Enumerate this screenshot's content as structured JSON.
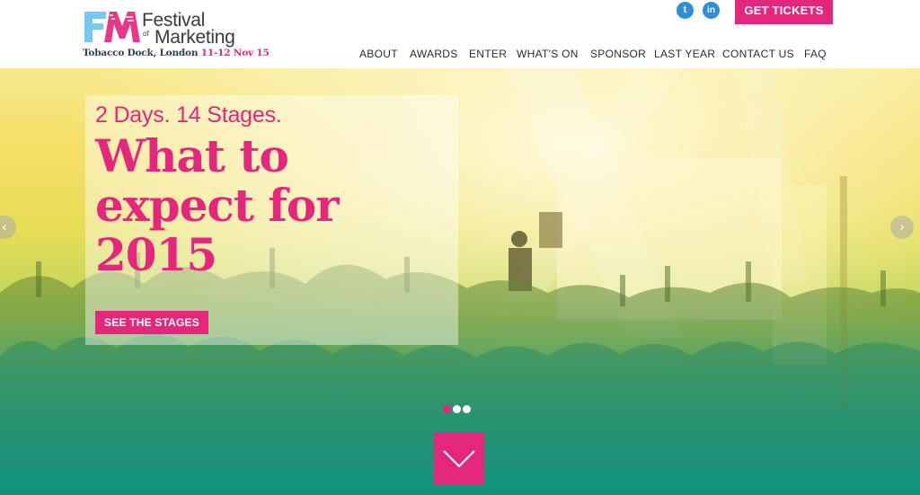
{
  "brand": {
    "name_line1": "Festival",
    "name_of": "of",
    "name_line2": "Marketing",
    "venue": "Tobacco Dock, London",
    "dates": "11-12 Nov 15",
    "colors": {
      "pink": "#e5267d",
      "blue": "#2e8fd5",
      "cyan": "#74c9ee",
      "text": "#3a3a3a"
    }
  },
  "social": [
    {
      "name": "twitter",
      "icon": "twitter-bird-icon",
      "glyph": "t"
    },
    {
      "name": "linkedin",
      "icon": "linkedin-icon",
      "glyph": "in"
    }
  ],
  "header": {
    "cta_label": "GET TICKETS"
  },
  "nav": [
    "ABOUT",
    "AWARDS",
    "ENTER",
    "WHAT'S ON",
    "SPONSOR",
    "LAST YEAR",
    "CONTACT US",
    "FAQ"
  ],
  "hero": {
    "subtitle": "2 Days. 14 Stages.",
    "title": "What to expect for 2015",
    "button_label": "SEE THE STAGES",
    "prev_icon": "chevron-left-icon",
    "next_icon": "chevron-right-icon",
    "prev_glyph": "‹",
    "next_glyph": "›",
    "slides_total": 3,
    "active_slide": 1,
    "scroll_icon": "chevron-down-icon"
  }
}
